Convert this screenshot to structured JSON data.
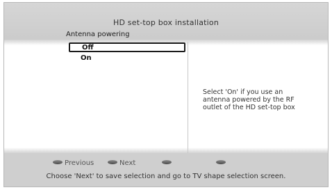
{
  "header": {
    "title": "HD set-top box installation",
    "subtitle": "Antenna powering"
  },
  "options": [
    {
      "label": "Off",
      "selected": true
    },
    {
      "label": "On",
      "selected": false
    }
  ],
  "help_text": "Select 'On' if you use an antenna powered by the RF outlet of the HD set-top box",
  "keys": {
    "previous": "Previous",
    "next": "Next"
  },
  "footer_hint": "Choose 'Next' to save selection and go to TV shape selection screen."
}
